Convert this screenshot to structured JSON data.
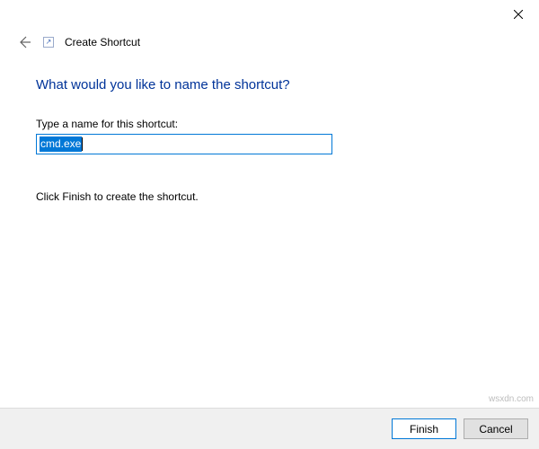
{
  "titlebar": {
    "close_label": "Close"
  },
  "header": {
    "wizard_title": "Create Shortcut"
  },
  "main": {
    "heading": "What would you like to name the shortcut?",
    "field_label": "Type a name for this shortcut:",
    "input_value": "cmd.exe",
    "hint": "Click Finish to create the shortcut."
  },
  "buttons": {
    "finish": "Finish",
    "cancel": "Cancel"
  },
  "watermark": "wsxdn.com"
}
